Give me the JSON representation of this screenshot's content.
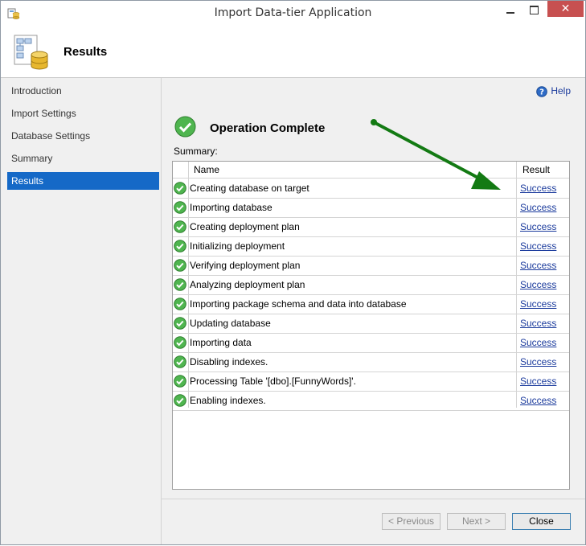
{
  "window": {
    "title": "Import Data-tier Application",
    "close_glyph": "✕"
  },
  "header": {
    "title": "Results"
  },
  "sidebar": {
    "items": [
      {
        "label": "Introduction",
        "active": false
      },
      {
        "label": "Import Settings",
        "active": false
      },
      {
        "label": "Database Settings",
        "active": false
      },
      {
        "label": "Summary",
        "active": false
      },
      {
        "label": "Results",
        "active": true
      }
    ]
  },
  "main": {
    "help_label": "Help",
    "status": "Operation Complete",
    "summary_label": "Summary:",
    "columns": {
      "name": "Name",
      "result": "Result"
    },
    "rows": [
      {
        "name": "Creating database on target",
        "result": "Success"
      },
      {
        "name": "Importing database",
        "result": "Success"
      },
      {
        "name": "Creating deployment plan",
        "result": "Success"
      },
      {
        "name": "Initializing deployment",
        "result": "Success"
      },
      {
        "name": "Verifying deployment plan",
        "result": "Success"
      },
      {
        "name": "Analyzing deployment plan",
        "result": "Success"
      },
      {
        "name": "Importing package schema and data into database",
        "result": "Success"
      },
      {
        "name": "Updating database",
        "result": "Success"
      },
      {
        "name": "Importing data",
        "result": "Success"
      },
      {
        "name": "Disabling indexes.",
        "result": "Success"
      },
      {
        "name": "Processing Table '[dbo].[FunnyWords]'.",
        "result": "Success"
      },
      {
        "name": "Enabling indexes.",
        "result": "Success"
      }
    ]
  },
  "footer": {
    "previous_label": "< Previous",
    "next_label": "Next >",
    "close_label": "Close"
  },
  "colors": {
    "selection": "#1569c7",
    "link": "#1a3a9c",
    "success_green": "#3aa23a",
    "annotation_arrow": "#137a13"
  },
  "icons": {
    "row_status": "check-circle-icon",
    "help": "help-icon",
    "header": "database-package-icon"
  }
}
